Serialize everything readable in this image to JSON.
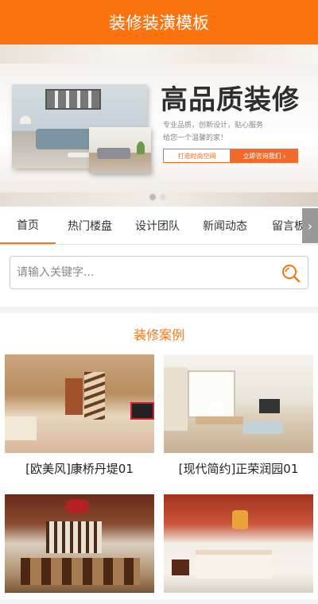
{
  "header": {
    "title": "装修装潢模板"
  },
  "banner": {
    "headline": "高品质装修",
    "sub_line1": "专业品质，创新设计，贴心服务",
    "sub_line2": "给您一个温馨的家！",
    "button_primary": "打造时尚空间",
    "button_secondary": "立即咨询我们 ›",
    "slide_count": 2,
    "active_slide": 1
  },
  "nav": {
    "items": [
      "首页",
      "热门楼盘",
      "设计团队",
      "新闻动态",
      "留言板"
    ],
    "active_index": 0,
    "arrow_icon": "chevron-right-icon"
  },
  "search": {
    "placeholder": "请输入关键字...",
    "value": "",
    "icon": "search-icon"
  },
  "cases": {
    "section_title": "装修案例",
    "items": [
      {
        "caption": "[欧美风]康桥丹堤01"
      },
      {
        "caption": "[现代简约]正荣润园01"
      },
      {
        "caption": ""
      },
      {
        "caption": ""
      }
    ]
  },
  "colors": {
    "primary": "#fb7410",
    "button_accent": "#f26b2a",
    "text_dark": "#222222"
  }
}
